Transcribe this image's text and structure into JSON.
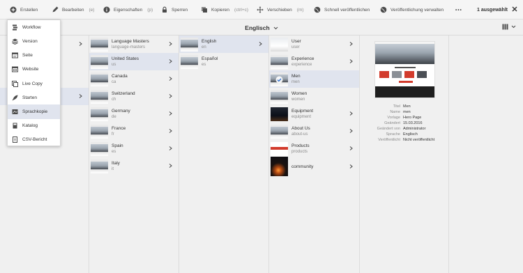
{
  "toolbar": {
    "items": [
      {
        "label": "Erstellen",
        "hint": "",
        "icon": "plus-circle-icon"
      },
      {
        "label": "Bearbeiten",
        "hint": "(e)",
        "icon": "pencil-icon"
      },
      {
        "label": "Eigenschaften",
        "hint": "(p)",
        "icon": "info-icon"
      },
      {
        "label": "Sperren",
        "hint": "",
        "icon": "lock-icon"
      },
      {
        "label": "Kopieren",
        "hint": "(ctrl+c)",
        "icon": "copy-icon"
      },
      {
        "label": "Verschieben",
        "hint": "(m)",
        "icon": "move-icon"
      },
      {
        "label": "Schnell veröffentlichen",
        "hint": "",
        "icon": "globe-icon"
      },
      {
        "label": "Veröffentlichung verwalten",
        "hint": "",
        "icon": "globe-manage-icon"
      }
    ],
    "more": "•••",
    "selection": "1 ausgewählt"
  },
  "title": "Englisch",
  "menu": {
    "items": [
      {
        "label": "Workflow",
        "icon": "workflow-icon"
      },
      {
        "label": "Version",
        "icon": "layers-icon"
      },
      {
        "label": "Seite",
        "icon": "page-icon"
      },
      {
        "label": "Website",
        "icon": "website-icon"
      },
      {
        "label": "Live Copy",
        "icon": "livecopy-icon"
      },
      {
        "label": "Starten",
        "icon": "rocket-icon"
      },
      {
        "label": "Sprachkopie",
        "icon": "language-copy-icon"
      },
      {
        "label": "Katalog",
        "icon": "catalog-icon"
      },
      {
        "label": "CSV-Bericht",
        "icon": "csv-icon"
      }
    ]
  },
  "columns": {
    "countries": [
      {
        "title": "Language Masters",
        "name": "language-masters"
      },
      {
        "title": "United States",
        "name": "us"
      },
      {
        "title": "Canada",
        "name": "ca"
      },
      {
        "title": "Switzerland",
        "name": "ch"
      },
      {
        "title": "Germany",
        "name": "de"
      },
      {
        "title": "France",
        "name": "fr"
      },
      {
        "title": "Spain",
        "name": "es"
      },
      {
        "title": "Italy",
        "name": "it"
      }
    ],
    "languages": [
      {
        "title": "English",
        "name": "en"
      },
      {
        "title": "Español",
        "name": "es"
      }
    ],
    "pages": [
      {
        "title": "User",
        "name": "user"
      },
      {
        "title": "Experience",
        "name": "experience"
      },
      {
        "title": "Men",
        "name": "men"
      },
      {
        "title": "Women",
        "name": "women"
      },
      {
        "title": "Equipment",
        "name": "equipment"
      },
      {
        "title": "About Us",
        "name": "about-us"
      },
      {
        "title": "Products",
        "name": "products"
      },
      {
        "title": "community",
        "name": ""
      }
    ]
  },
  "details": [
    {
      "key": "Titel",
      "value": "Men"
    },
    {
      "key": "Name",
      "value": "men"
    },
    {
      "key": "Vorlage",
      "value": "Hero Page"
    },
    {
      "key": "Geändert",
      "value": "15.03.2016"
    },
    {
      "key": "Geändert von",
      "value": "Administrator"
    },
    {
      "key": "Sprache",
      "value": "Englisch"
    },
    {
      "key": "Veröffentlicht",
      "value": "Nicht veröffentlicht"
    }
  ],
  "colors": {
    "accent": "#e0e4ee",
    "text": "#323232",
    "muted": "#8a8a8a"
  }
}
